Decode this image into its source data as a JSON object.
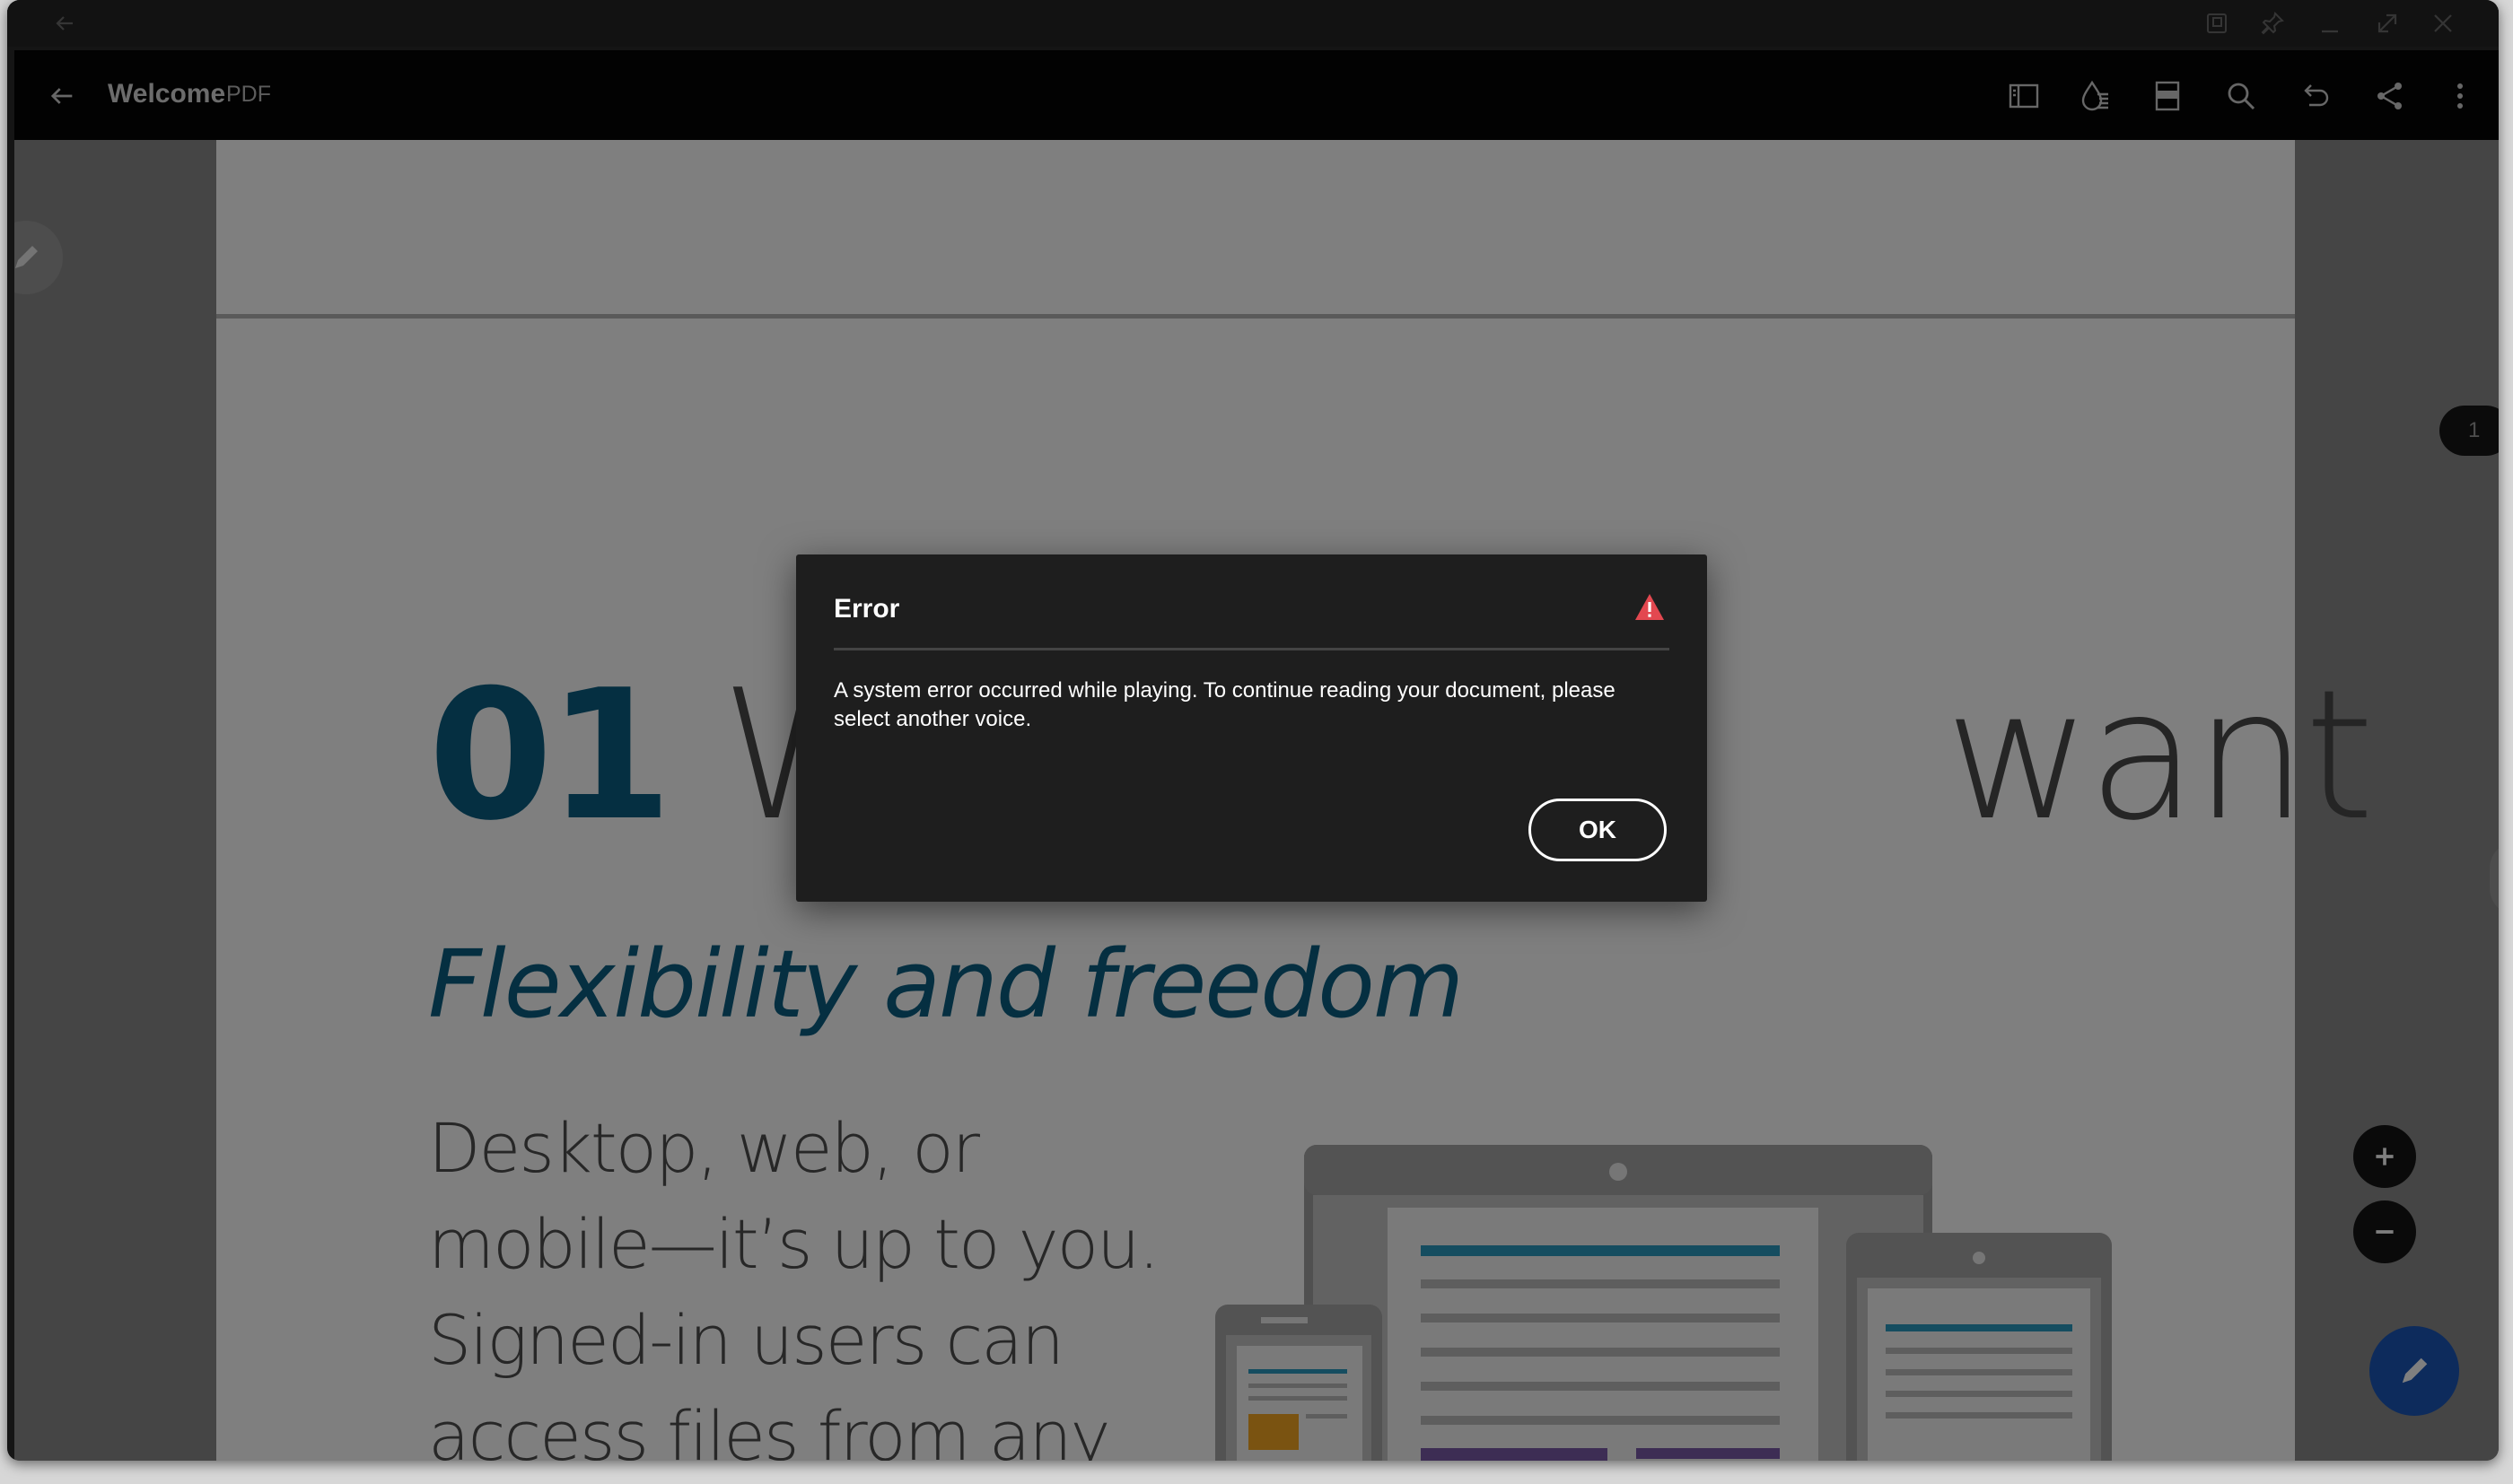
{
  "document": {
    "title": "Welcome",
    "type": "PDF",
    "page_number": "1",
    "heading_number": "01",
    "heading_left": "Wo",
    "heading_right": "want",
    "subheading": "Flexibility and freedom",
    "body_lines": [
      "Desktop, web, or",
      "mobile—it’s up to you.",
      "Signed-in users can",
      "access files from any"
    ]
  },
  "dialog": {
    "title": "Error",
    "message": "A system error occurred while playing. To continue reading your document, please select another voice.",
    "ok_label": "OK"
  },
  "colors": {
    "brand_blue": "#0a5f82",
    "fab_blue": "#1a56b9",
    "warning_red": "#e34850"
  },
  "icons": {
    "toolbar": [
      "sidebar-icon",
      "liquid-mode-icon",
      "page-layout-icon",
      "search-icon",
      "undo-icon",
      "share-icon",
      "more-icon"
    ],
    "window": [
      "back-icon",
      "compact-overlay-icon",
      "pin-icon",
      "minimize-icon",
      "maximize-icon",
      "close-icon"
    ]
  }
}
